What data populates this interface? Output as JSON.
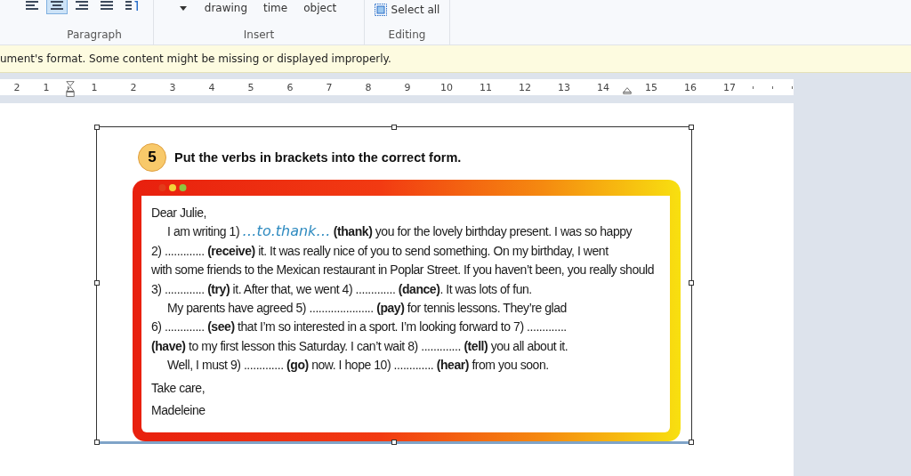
{
  "ribbon": {
    "paragraph": {
      "align_buttons": [
        {
          "selected": false
        },
        {
          "selected": true
        },
        {
          "selected": false
        },
        {
          "selected": false
        },
        {
          "selected": false
        }
      ],
      "label": "Paragraph"
    },
    "insert": {
      "buttons": [
        "drawing",
        "time",
        "object"
      ],
      "label": "Insert"
    },
    "editing": {
      "select_all": "Select all",
      "label": "Editing"
    }
  },
  "notification": "ument's format. Some content might be missing or displayed improperly.",
  "ruler": {
    "left_labels": [
      "2",
      "1"
    ],
    "labels": [
      "1",
      "2",
      "3",
      "4",
      "5",
      "6",
      "7",
      "8",
      "9",
      "10",
      "11",
      "12",
      "13",
      "14"
    ],
    "right_labels": [
      "15",
      "16",
      "17"
    ]
  },
  "exercise": {
    "number": "5",
    "instruction": "Put the verbs in brackets into the correct form.",
    "letter": [
      {
        "indent": false,
        "parts": [
          {
            "kind": "text",
            "text": "Dear Julie,"
          }
        ]
      },
      {
        "indent": true,
        "parts": [
          {
            "kind": "text",
            "text": "I am writing 1) "
          },
          {
            "kind": "answer",
            "text": "…to.thank…"
          },
          {
            "kind": "text",
            "text": " **(thank)** you for the lovely birthday present. I was so happy"
          }
        ]
      },
      {
        "indent": false,
        "parts": [
          {
            "kind": "text",
            "text": "2) ............. **(receive)** it. It was really nice of you to send something. On my birthday, I went"
          }
        ]
      },
      {
        "indent": false,
        "parts": [
          {
            "kind": "text",
            "text": "with some friends to the Mexican restaurant in Poplar Street. If you haven’t been, you really should"
          }
        ]
      },
      {
        "indent": false,
        "parts": [
          {
            "kind": "text",
            "text": "3) ............. **(try)** it. After that, we went 4) ............. **(dance)**. It was lots of fun."
          }
        ]
      },
      {
        "indent": true,
        "parts": [
          {
            "kind": "text",
            "text": "My parents have agreed 5) ..................... **(pay)** for tennis lessons. They’re glad"
          }
        ]
      },
      {
        "indent": false,
        "parts": [
          {
            "kind": "text",
            "text": "6) ............. **(see)** that I’m so interested in a sport. I’m looking forward to 7) ............."
          }
        ]
      },
      {
        "indent": false,
        "parts": [
          {
            "kind": "text",
            "text": "**(have)** to my first lesson this Saturday. I can’t wait 8) ............. **(tell)** you all about it."
          }
        ]
      },
      {
        "indent": true,
        "parts": [
          {
            "kind": "text",
            "text": "Well, I must 9) ............. **(go)** now. I hope 10) ............. **(hear)** from you soon."
          }
        ]
      },
      {
        "indent": false,
        "parts": [
          {
            "kind": "text",
            "text": "Take care,"
          }
        ]
      },
      {
        "indent": false,
        "parts": [
          {
            "kind": "text",
            "text": "Madeleine"
          }
        ]
      }
    ]
  }
}
